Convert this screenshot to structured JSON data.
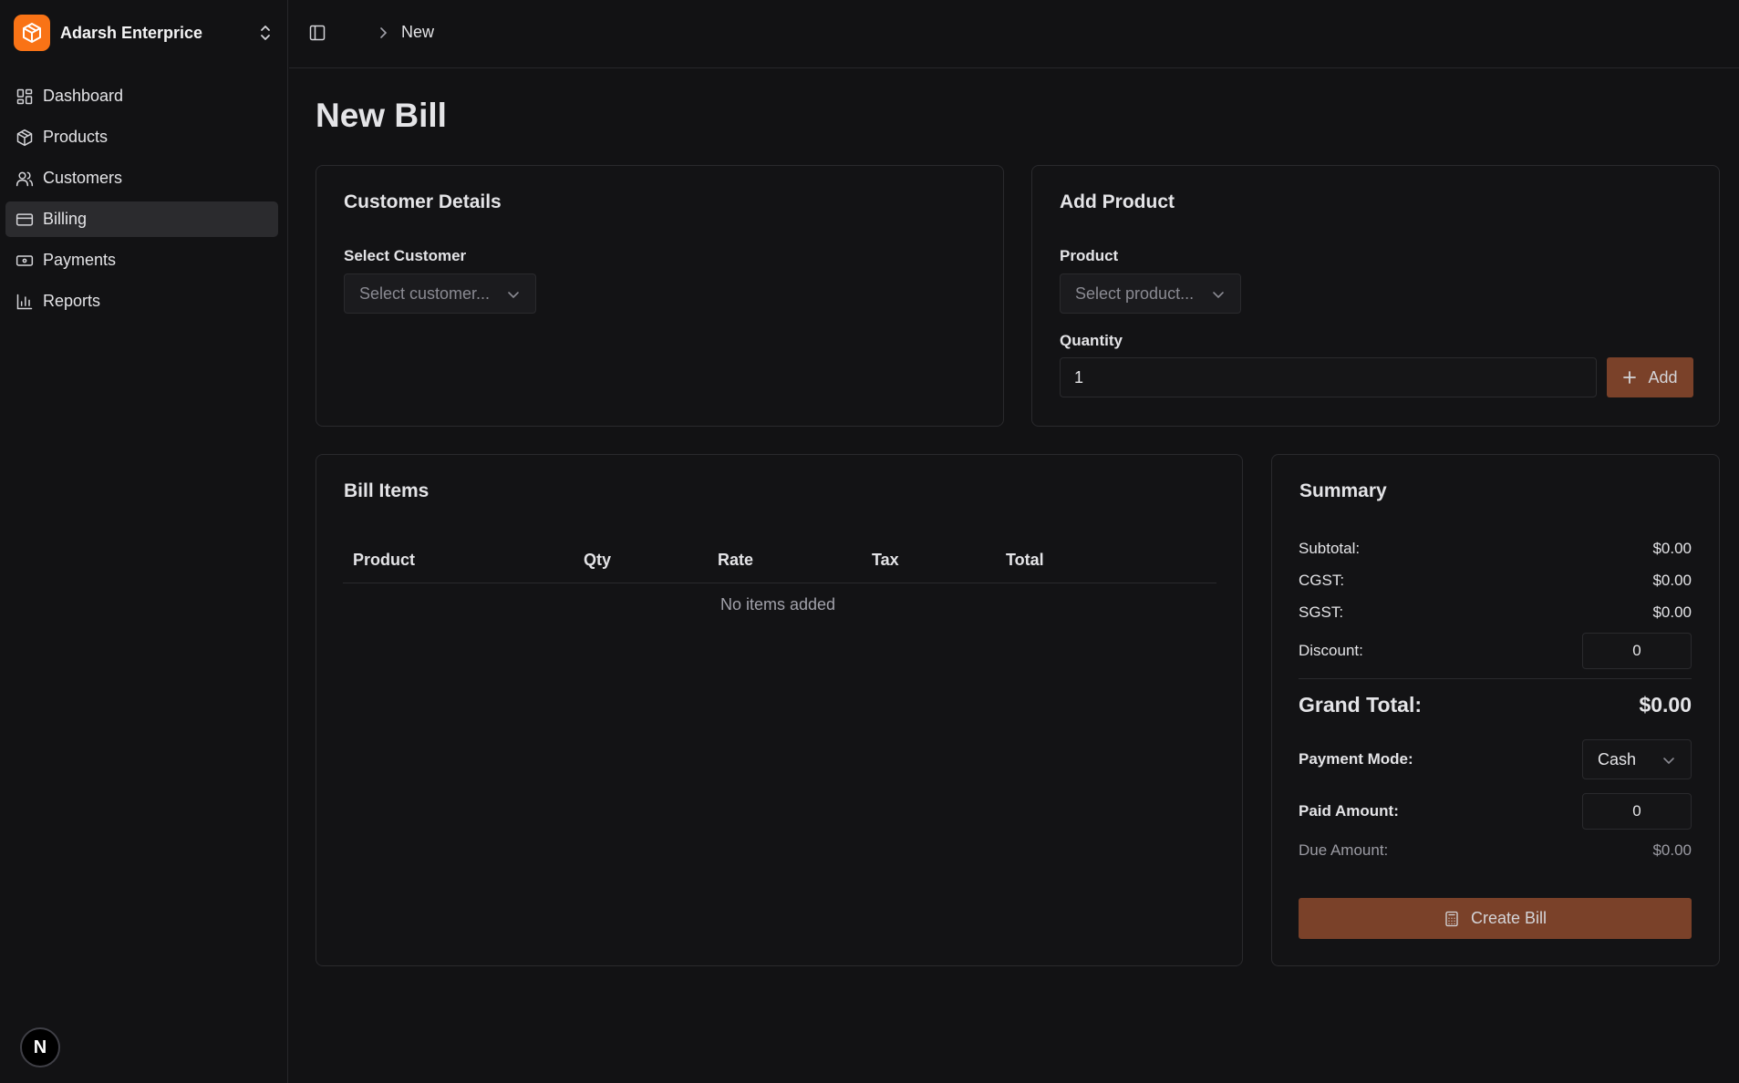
{
  "colors": {
    "background": "#121214",
    "brand": "#f97316",
    "accent_button": "#7a4129",
    "active_nav": "#2b2b2e",
    "border": "#2a2a2d"
  },
  "sidebar": {
    "brand_name": "Adarsh Enterprice",
    "brand_icon": "box-icon",
    "switch_icon": "chevrons-up-down-icon",
    "items": [
      {
        "label": "Dashboard",
        "icon": "layout-dashboard-icon",
        "active": false
      },
      {
        "label": "Products",
        "icon": "package-icon",
        "active": false
      },
      {
        "label": "Customers",
        "icon": "users-icon",
        "active": false
      },
      {
        "label": "Billing",
        "icon": "credit-card-icon",
        "active": true
      },
      {
        "label": "Payments",
        "icon": "banknote-icon",
        "active": false
      },
      {
        "label": "Reports",
        "icon": "bar-chart-icon",
        "active": false
      }
    ],
    "badge": "N"
  },
  "topbar": {
    "breadcrumb_current": "New"
  },
  "page": {
    "title": "New Bill"
  },
  "customer_details": {
    "title": "Customer Details",
    "select_label": "Select Customer",
    "select_placeholder": "Select customer..."
  },
  "add_product": {
    "title": "Add Product",
    "product_label": "Product",
    "product_placeholder": "Select product...",
    "quantity_label": "Quantity",
    "quantity_value": "1",
    "add_label": "Add"
  },
  "bill_items": {
    "title": "Bill Items",
    "columns": [
      "Product",
      "Qty",
      "Rate",
      "Tax",
      "Total"
    ],
    "empty_text": "No items added"
  },
  "summary": {
    "title": "Summary",
    "subtotal_label": "Subtotal:",
    "subtotal_value": "$0.00",
    "cgst_label": "CGST:",
    "cgst_value": "$0.00",
    "sgst_label": "SGST:",
    "sgst_value": "$0.00",
    "discount_label": "Discount:",
    "discount_value": "0",
    "grand_total_label": "Grand Total:",
    "grand_total_value": "$0.00",
    "payment_mode_label": "Payment Mode:",
    "payment_mode_value": "Cash",
    "paid_amount_label": "Paid Amount:",
    "paid_amount_value": "0",
    "due_amount_label": "Due Amount:",
    "due_amount_value": "$0.00",
    "create_label": "Create Bill"
  }
}
